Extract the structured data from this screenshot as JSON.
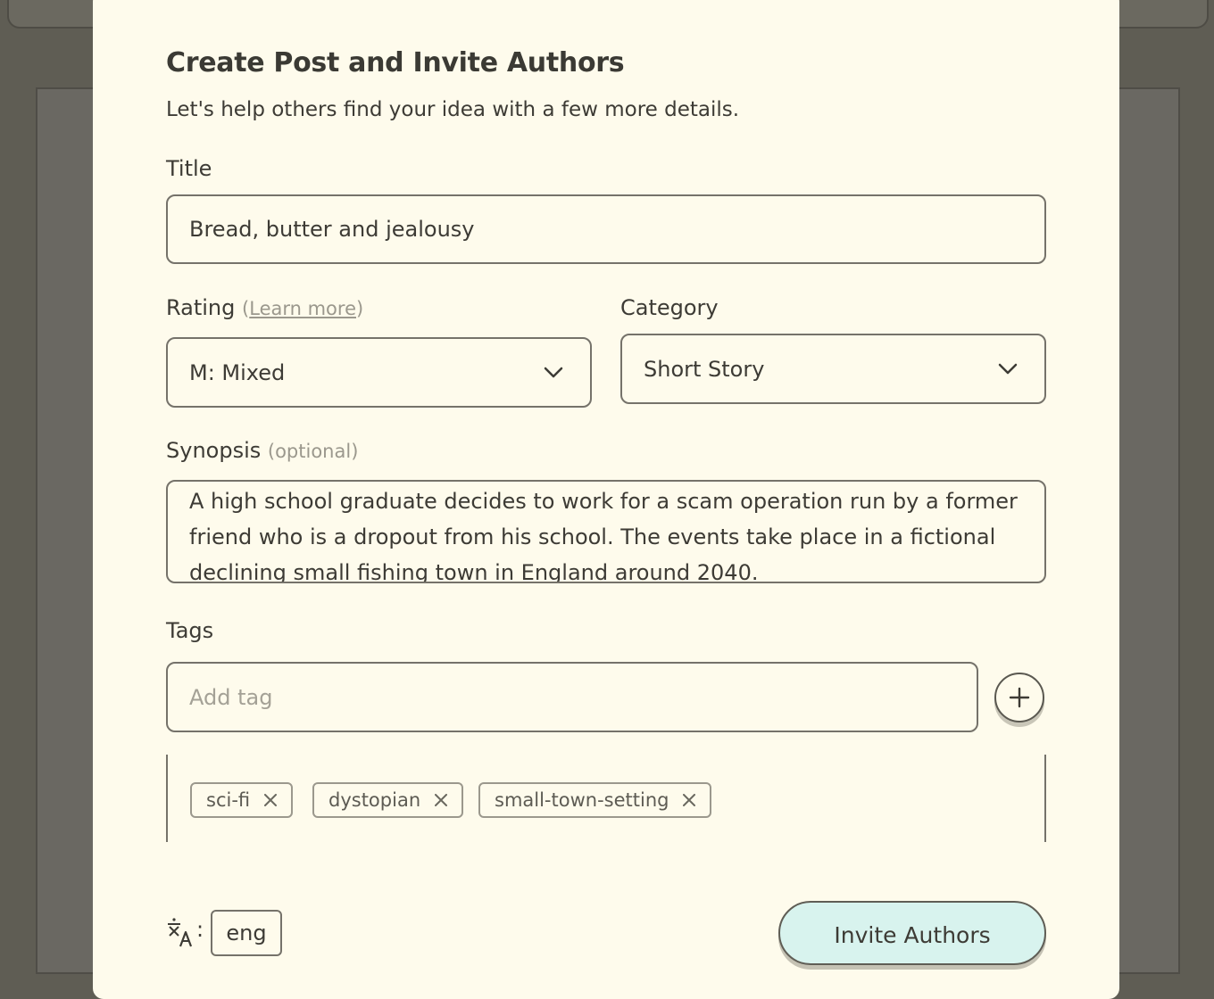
{
  "modal": {
    "title": "Create Post and Invite Authors",
    "subtitle": "Let's help others find your idea with a few more details."
  },
  "title_field": {
    "label": "Title",
    "value": "Bread, butter and jealousy"
  },
  "rating": {
    "label": "Rating",
    "paren_open": "(",
    "learn_more": "Learn more",
    "paren_close": ")",
    "value": "M: Mixed",
    "icon": "chevron-down-icon"
  },
  "category": {
    "label": "Category",
    "value": "Short Story",
    "icon": "chevron-down-icon"
  },
  "synopsis": {
    "label": "Synopsis",
    "optional": "(optional)",
    "value": "A high school graduate decides to work for a scam operation run by a former friend who is a dropout from his school. The events take place in a fictional declining small fishing town in England around 2040."
  },
  "tags": {
    "label": "Tags",
    "placeholder": "Add tag",
    "add_icon": "plus-icon",
    "items": [
      {
        "label": "sci-fi"
      },
      {
        "label": "dystopian"
      },
      {
        "label": "small-town-setting"
      }
    ]
  },
  "footer": {
    "language_icon": "translate-icon",
    "colon": ":",
    "language": "eng",
    "invite_button": "Invite Authors"
  },
  "colors": {
    "modal_bg": "#fefbec",
    "overlay": "#5f5d54",
    "button_accent": "#d8f3ee",
    "border": "#75726a"
  }
}
